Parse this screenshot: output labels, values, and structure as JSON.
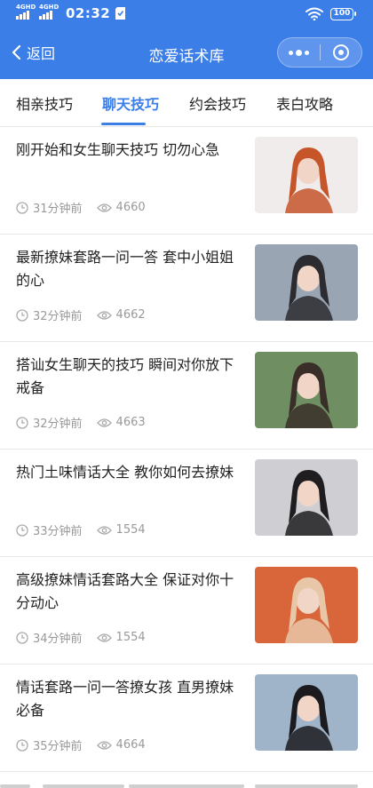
{
  "status_bar": {
    "net1": "4GHD",
    "net2": "4GHD",
    "time": "02:32",
    "battery": "100"
  },
  "nav": {
    "back_label": "返回",
    "title": "恋爱话术库"
  },
  "tabs": [
    {
      "label": "相亲技巧",
      "active": false
    },
    {
      "label": "聊天技巧",
      "active": true
    },
    {
      "label": "约会技巧",
      "active": false
    },
    {
      "label": "表白攻略",
      "active": false
    }
  ],
  "articles": [
    {
      "title": "刚开始和女生聊天技巧 切勿心急",
      "time": "31分钟前",
      "views": "4660",
      "thumb_bg": "#efeceb",
      "thumb_accent": "#c6552a"
    },
    {
      "title": "最新撩妹套路一问一答 套中小姐姐的心",
      "time": "32分钟前",
      "views": "4662",
      "thumb_bg": "#9aa5b4",
      "thumb_accent": "#2b2b30"
    },
    {
      "title": "搭讪女生聊天的技巧 瞬间对你放下戒备",
      "time": "32分钟前",
      "views": "4663",
      "thumb_bg": "#6f8f62",
      "thumb_accent": "#3a2f28"
    },
    {
      "title": "热门土味情话大全 教你如何去撩妹",
      "time": "33分钟前",
      "views": "1554",
      "thumb_bg": "#cfcfd3",
      "thumb_accent": "#1f1d1f"
    },
    {
      "title": "高级撩妹情话套路大全 保证对你十分动心",
      "time": "34分钟前",
      "views": "1554",
      "thumb_bg": "#d9653a",
      "thumb_accent": "#e8c7a8"
    },
    {
      "title": "情话套路一问一答撩女孩 直男撩妹必备",
      "time": "35分钟前",
      "views": "4664",
      "thumb_bg": "#9fb4c8",
      "thumb_accent": "#1b1b1f"
    }
  ],
  "colors": {
    "brand_blue": "#3c7ee8",
    "meta_gray": "#999999"
  }
}
